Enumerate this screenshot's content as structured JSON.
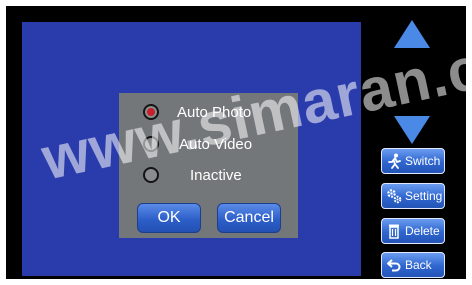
{
  "dialog": {
    "options": [
      {
        "label": "Auto Photo",
        "selected": true
      },
      {
        "label": "Auto Video",
        "selected": false
      },
      {
        "label": "Inactive",
        "selected": false
      }
    ],
    "ok_label": "OK",
    "cancel_label": "Cancel"
  },
  "sidebar": {
    "switch_label": "Switch",
    "setting_label": "Setting",
    "delete_label": "Delete",
    "back_label": "Back"
  },
  "watermark": {
    "text": "www.simaran.co"
  },
  "colors": {
    "viewport_bg": "#2a3cac",
    "dialog_bg": "#74777a",
    "button_blue": "#2d5fc9",
    "arrow_blue": "#4a8ae6",
    "radio_selected": "#c8202a"
  },
  "icons": {
    "up": "triangle-up-icon",
    "down": "triangle-down-icon",
    "switch": "running-person-icon",
    "setting": "gears-icon",
    "delete": "trash-icon",
    "back": "back-arrow-icon"
  }
}
